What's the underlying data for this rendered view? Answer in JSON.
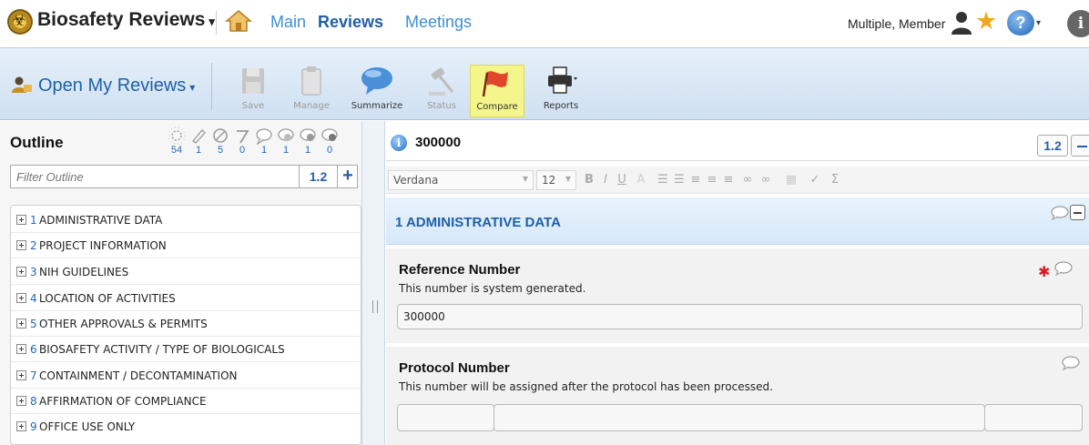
{
  "app": {
    "title": "Biosafety Reviews",
    "title_caret": "▾",
    "nav_tabs": [
      {
        "label": "Main"
      },
      {
        "label": "Reviews"
      },
      {
        "label": "Meetings"
      }
    ],
    "user_name": "Multiple, Member",
    "icons": [
      "biohazard-logo",
      "home-icon",
      "user-icon",
      "star-icon",
      "help-icon",
      "info-icon"
    ]
  },
  "toolbar": {
    "open_reviews": "Open My Reviews",
    "caret": "▾",
    "buttons": [
      {
        "label": "Save",
        "icon": "save-icon",
        "enabled": false
      },
      {
        "label": "Manage",
        "icon": "clipboard-icon",
        "enabled": false
      },
      {
        "label": "Summarize",
        "icon": "speech-bubble-icon",
        "enabled": true
      },
      {
        "label": "Status",
        "icon": "gavel-icon",
        "enabled": false
      },
      {
        "label": "Compare",
        "icon": "flag-icon",
        "enabled": true,
        "highlighted": true
      },
      {
        "label": "Reports",
        "icon": "printer-icon",
        "enabled": true
      }
    ]
  },
  "outline": {
    "title": "Outline",
    "status_counts": [
      "54",
      "1",
      "5",
      "0",
      "1",
      "1",
      "1",
      "0"
    ],
    "filter_placeholder": "Filter Outline",
    "size_label": "1.2",
    "add_label": "+",
    "items": [
      {
        "num": "1",
        "text": "ADMINISTRATIVE DATA"
      },
      {
        "num": "2",
        "text": "PROJECT INFORMATION"
      },
      {
        "num": "3",
        "text": "NIH GUIDELINES"
      },
      {
        "num": "4",
        "text": "LOCATION OF ACTIVITIES"
      },
      {
        "num": "5",
        "text": "OTHER APPROVALS & PERMITS"
      },
      {
        "num": "6",
        "text": "BIOSAFETY ACTIVITY / TYPE OF BIOLOGICALS"
      },
      {
        "num": "7",
        "text": "CONTAINMENT / DECONTAMINATION"
      },
      {
        "num": "8",
        "text": "AFFIRMATION OF COMPLIANCE"
      },
      {
        "num": "9",
        "text": "OFFICE USE ONLY"
      }
    ]
  },
  "document": {
    "id_title": "300000",
    "size_label": "1.2",
    "editor": {
      "font": "Verdana",
      "size": "12",
      "bold": "B",
      "italic": "I",
      "underline": "U",
      "sigma": "Σ"
    },
    "section_title": "1 ADMINISTRATIVE DATA",
    "fields": [
      {
        "label": "Reference Number",
        "help": "This number is system generated.",
        "value": "300000"
      },
      {
        "label": "Protocol Number",
        "help": "This number will be assigned after the protocol has been processed.",
        "value": ""
      }
    ]
  },
  "colors": {
    "accent": "#1f5fa8",
    "link": "#3d8fd1",
    "highlight": "#f4f58a",
    "required": "#d21e2b"
  }
}
